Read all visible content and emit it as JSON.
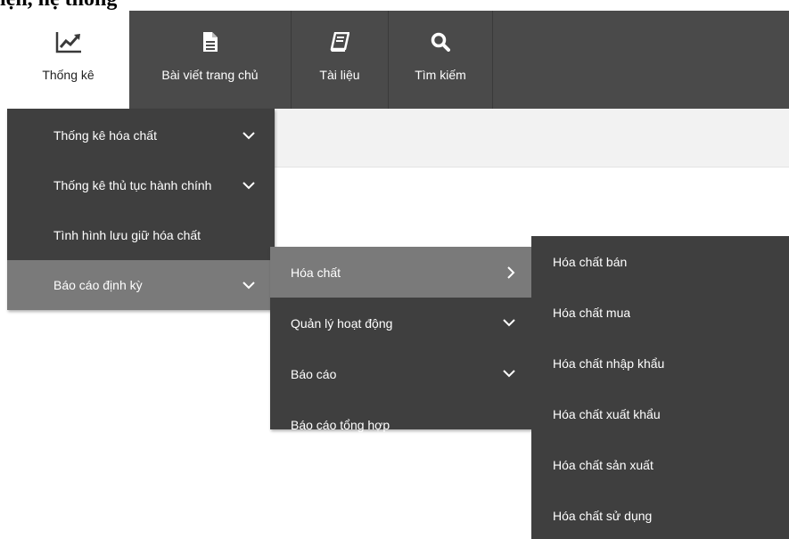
{
  "page_heading": "iện, hệ thống",
  "nav": {
    "tabs": [
      {
        "label": "Thống kê",
        "icon": "line-chart-icon",
        "active": true
      },
      {
        "label": "Bài viết trang chủ",
        "icon": "document-icon",
        "active": false
      },
      {
        "label": "Tài liệu",
        "icon": "book-icon",
        "active": false
      },
      {
        "label": "Tìm kiếm",
        "icon": "search-icon",
        "active": false
      }
    ]
  },
  "menu_level1": [
    {
      "label": "Thống kê hóa chất",
      "icon": "chevron-down-icon"
    },
    {
      "label": "Thống kê thủ tục hành chính",
      "icon": "chevron-down-icon"
    },
    {
      "label": "Tình hình lưu giữ hóa chất",
      "icon": ""
    },
    {
      "label": "Báo cáo định kỳ",
      "icon": "chevron-down-icon",
      "active": true
    }
  ],
  "menu_level2": [
    {
      "label": "Hóa chất",
      "icon": "chevron-right-icon",
      "active": true
    },
    {
      "label": "Quản lý hoạt động",
      "icon": "chevron-down-icon"
    },
    {
      "label": "Báo cáo",
      "icon": "chevron-down-icon"
    },
    {
      "label": "Báo cáo tổng hợp",
      "icon": ""
    }
  ],
  "menu_level3": [
    {
      "label": "Hóa chất bán"
    },
    {
      "label": "Hóa chất mua"
    },
    {
      "label": "Hóa chất nhập khẩu"
    },
    {
      "label": "Hóa chất xuất khẩu"
    },
    {
      "label": "Hóa chất sản xuất"
    },
    {
      "label": "Hóa chất sử dụng"
    }
  ],
  "colors": {
    "bar": "#4a4a4a",
    "menu": "#3f3f3f",
    "menu_active": "#7a7a7a",
    "tab_active": "#ffffff"
  }
}
